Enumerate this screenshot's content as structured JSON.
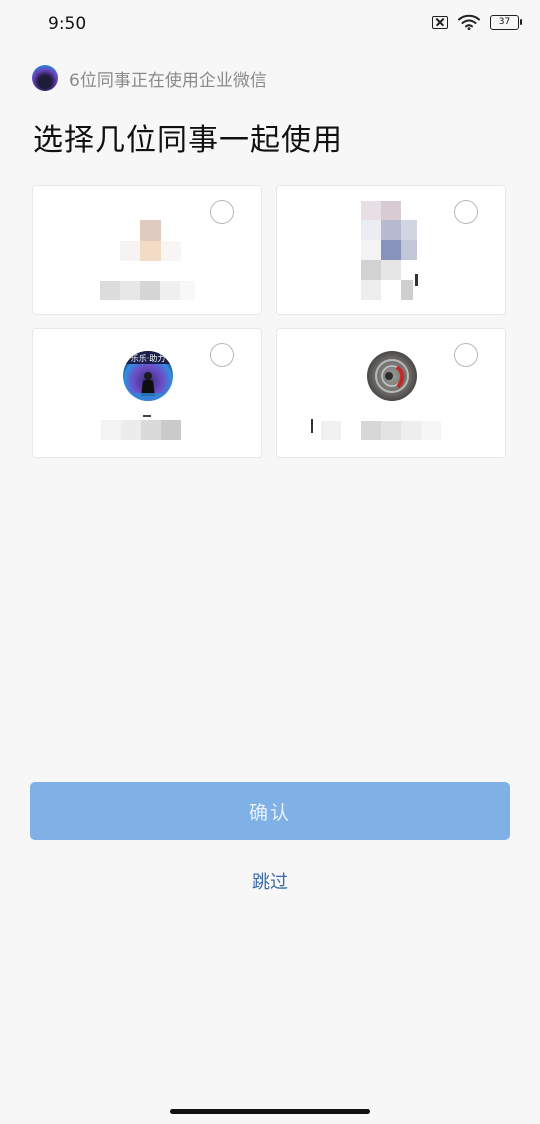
{
  "status_bar": {
    "time": "9:50",
    "battery": "37"
  },
  "header": {
    "company_info": "6位同事正在使用企业微信"
  },
  "title": "选择几位同事一起使用",
  "colleagues": [
    {
      "selected": false
    },
    {
      "selected": false
    },
    {
      "selected": false
    },
    {
      "selected": false
    }
  ],
  "actions": {
    "confirm_label": "确认",
    "skip_label": "跳过"
  },
  "colors": {
    "primary_disabled": "#7fb0e6",
    "link": "#3a6ba4",
    "background": "#f7f7f7"
  }
}
